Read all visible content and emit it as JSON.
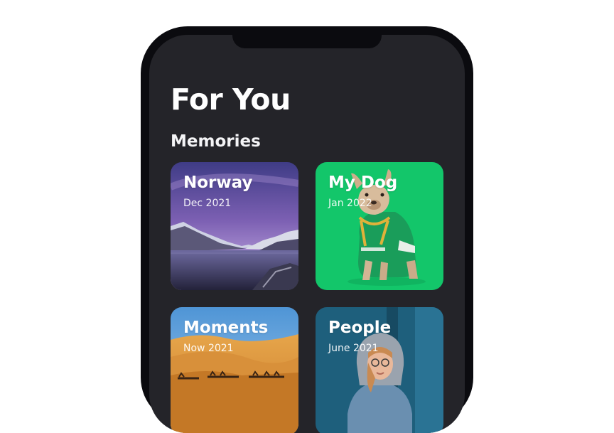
{
  "page": {
    "title": "For You",
    "section_title": "Memories"
  },
  "memories": [
    {
      "title": "Norway",
      "date": "Dec 2021",
      "image": "fjord-landscape-photo"
    },
    {
      "title": "My Dog",
      "date": "Jan 2022",
      "image": "french-bulldog-photo"
    },
    {
      "title": "Moments",
      "date": "Now 2021",
      "image": "desert-camels-photo"
    },
    {
      "title": "People",
      "date": "June 2021",
      "image": "woman-in-hoodie-photo"
    }
  ],
  "colors": {
    "screen_background": "#242429",
    "phone_frame": "#0b0b0f",
    "dog_card_green": "#13c66a"
  }
}
